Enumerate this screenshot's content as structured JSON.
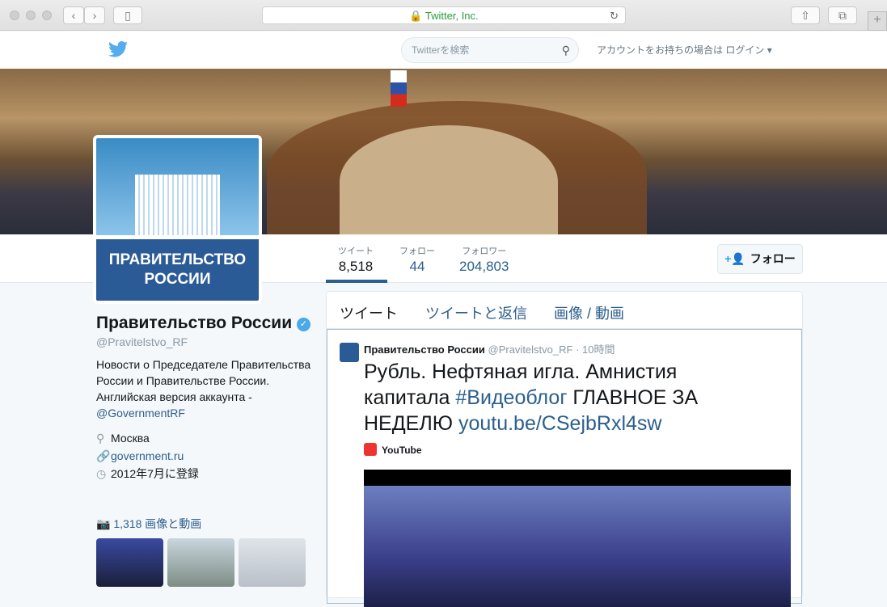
{
  "browser": {
    "url_title": "Twitter, Inc."
  },
  "topbar": {
    "search_placeholder": "Twitterを検索",
    "login_prompt": "アカウントをお持ちの場合は ログイン"
  },
  "stats": [
    {
      "label": "ツイート",
      "value": "8,518"
    },
    {
      "label": "フォロー",
      "value": "44"
    },
    {
      "label": "フォロワー",
      "value": "204,803"
    }
  ],
  "follow_label": "フォロー",
  "avatar_text": "ПРАВИТЕЛЬСТВО РОССИИ",
  "profile": {
    "name": "Правительство России",
    "handle": "@Pravitelstvo_RF",
    "bio": "Новости о Председателе Правительства России и Правительстве России. Английская версия аккаунта - ",
    "bio_link": "@GovernmentRF",
    "location": "Москва",
    "website": "government.ru",
    "joined": "2012年7月に登録",
    "media": "1,318 画像と動画"
  },
  "tabs": [
    "ツイート",
    "ツイートと返信",
    "画像 / 動画"
  ],
  "tweet": {
    "name": "Правительство России",
    "handle": "@Pravitelstvo_RF",
    "time": "10時間",
    "text1": "Рубль. Нефтяная игла. Амнистия капитала ",
    "hashtag": "#Видеоблог",
    "text2": " ГЛАВНОЕ ЗА НЕДЕЛЮ ",
    "link": "youtu.be/CSejbRxl4sw",
    "source": "YouTube"
  },
  "colors": {
    "link": "#2b5f8d",
    "twitter_blue": "#55acee"
  }
}
